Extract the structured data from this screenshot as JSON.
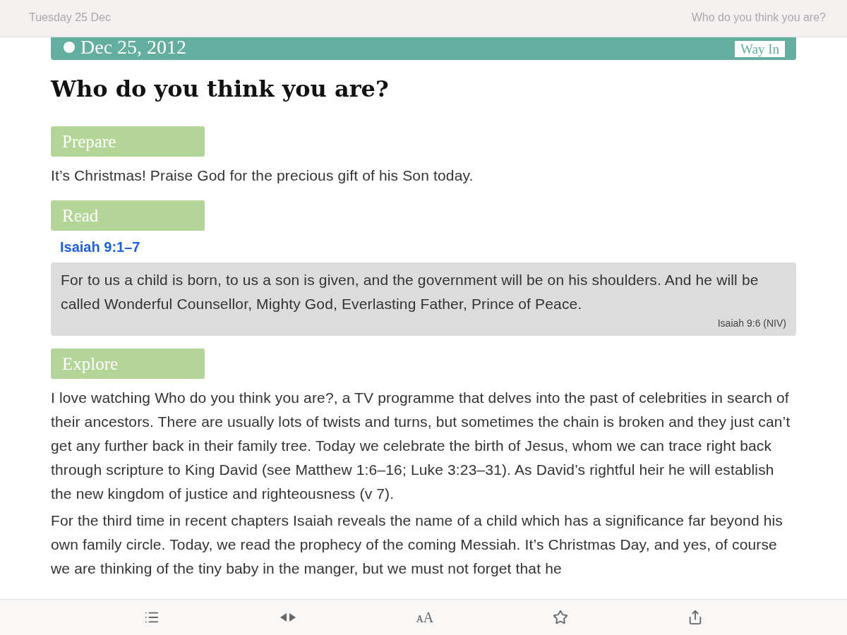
{
  "top_bar": {
    "date": "Tuesday 25 Dec",
    "title": "Who do you think you are?"
  },
  "banner": {
    "date": "Dec 25, 2012",
    "tag": "Way In"
  },
  "title": "Who do you think you are?",
  "sections": [
    {
      "kind": "text",
      "heading": "Prepare",
      "paragraphs": [
        "It’s Christmas! Praise God for the precious gift of his Son today."
      ]
    },
    {
      "kind": "reading",
      "heading": "Read",
      "reference": "Isaiah 9:1–7",
      "quote": "For to us a child is born, to us a son is given, and the government will be on his shoulders. And he will be called Wonderful Counsellor, Mighty God, Everlasting Father, Prince of Peace.",
      "citation": "Isaiah 9:6 (NIV)"
    },
    {
      "kind": "text",
      "heading": "Explore",
      "paragraphs": [
        "I love watching Who do you think you are?, a TV programme that delves into the past of celebrities in search of their ancestors. There are usually lots of twists and turns, but sometimes the chain is broken and they just can’t get any further back in their family tree. Today we celebrate the birth of Jesus, whom we can trace right back through scripture to King David (see Matthew 1:6–16; Luke 3:23–31). As David’s rightful heir he will establish the new kingdom of justice and righteousness (v 7).",
        "For the third time in recent chapters Isaiah reveals the name of a child which has a significance far beyond his own family circle. Today, we read the prophecy of the coming Messiah. It’s Christmas Day, and yes, of course we are thinking of the tiny baby in the manger, but we must not forget that he"
      ]
    }
  ],
  "toolbar": {
    "font_button": "ᴀA"
  }
}
